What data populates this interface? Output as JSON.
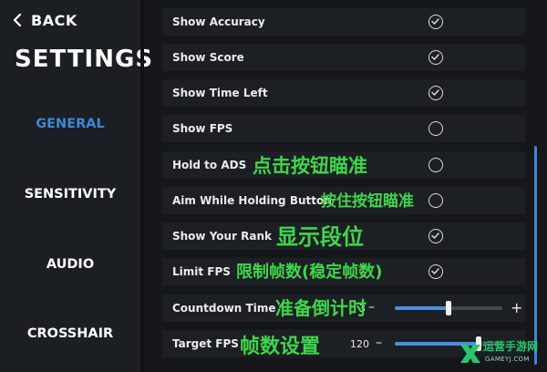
{
  "sidebar": {
    "back_label": "BACK",
    "title": "SETTINGS",
    "items": [
      {
        "label": "GENERAL",
        "active": true
      },
      {
        "label": "SENSITIVITY",
        "active": false
      },
      {
        "label": "AUDIO",
        "active": false
      },
      {
        "label": "CROSSHAIR",
        "active": false
      }
    ]
  },
  "settings": [
    {
      "label": "Show Accuracy",
      "checked": true
    },
    {
      "label": "Show Score",
      "checked": true
    },
    {
      "label": "Show Time Left",
      "checked": true
    },
    {
      "label": "Show FPS",
      "checked": false
    },
    {
      "label": "Hold to ADS",
      "checked": false
    },
    {
      "label": "Aim While Holding Button",
      "checked": false
    },
    {
      "label": "Show Your Rank",
      "checked": true
    },
    {
      "label": "Limit FPS",
      "checked": true
    }
  ],
  "sliders": [
    {
      "label": "Countdown Time",
      "value": "3",
      "fraction": 0.5
    },
    {
      "label": "Target FPS",
      "value": "120",
      "fraction": 0.78
    }
  ],
  "annotations": [
    "点击按钮瞄准",
    "按住按钮瞄准",
    "显示段位",
    "限制帧数(稳定帧数)",
    "准备倒计时",
    "帧数设置"
  ],
  "watermark": {
    "line1": "运营手游网",
    "line2": "GAMEYJ.COM"
  },
  "colors": {
    "accent": "#3c88d6",
    "annotation": "#3fd64a",
    "row_bg": "#1c1f24"
  }
}
